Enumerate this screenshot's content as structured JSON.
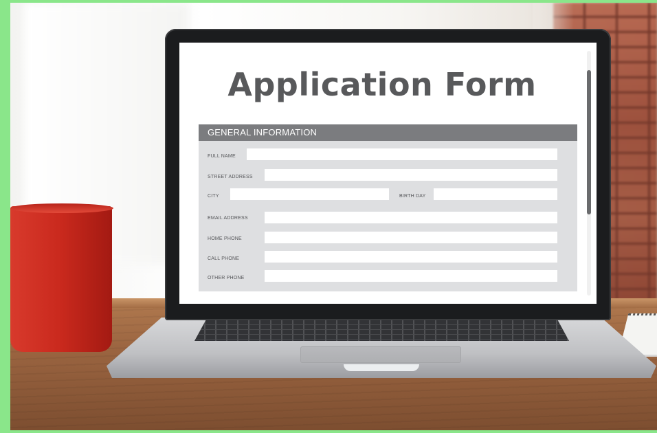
{
  "screen": {
    "title": "Application Form"
  },
  "form": {
    "section_title": "GENERAL INFORMATION",
    "fields": {
      "full_name": {
        "label": "FULL NAME",
        "value": ""
      },
      "street_address": {
        "label": "STREET ADDRESS",
        "value": ""
      },
      "city": {
        "label": "CITY",
        "value": ""
      },
      "birth_day": {
        "label": "BIRTH DAY",
        "value": ""
      },
      "email_address": {
        "label": "EMAIL ADDRESS",
        "value": ""
      },
      "home_phone": {
        "label": "HOME PHONE",
        "value": ""
      },
      "call_phone": {
        "label": "CALL PHONE",
        "value": ""
      },
      "other_phone": {
        "label": "OTHER PHONE",
        "value": ""
      }
    }
  },
  "colors": {
    "border": "#8ae68a",
    "title_text": "#58595b",
    "section_header": "#7b7c7f",
    "form_panel": "#dedfe1",
    "mug": "#c9291d"
  },
  "scene": {
    "objects": [
      "laptop",
      "red-mug",
      "notebook",
      "brick-wall",
      "wooden-table"
    ]
  }
}
